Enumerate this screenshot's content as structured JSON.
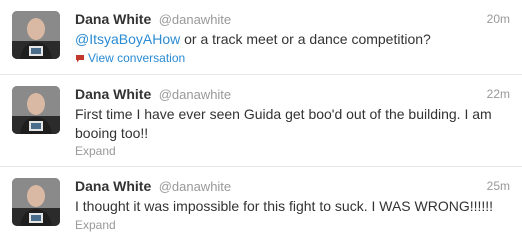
{
  "tweets": [
    {
      "name": "Dana White",
      "handle": "@danawhite",
      "time": "20m",
      "mention": "@ItsyaBoyAHow",
      "text": " or a track meet or a dance competition?",
      "action": "View conversation",
      "action_icon": "speech-bubble-icon"
    },
    {
      "name": "Dana White",
      "handle": "@danawhite",
      "time": "22m",
      "text": "First time I have ever seen Guida get boo'd out of the building. I am booing too!!",
      "action": "Expand"
    },
    {
      "name": "Dana White",
      "handle": "@danawhite",
      "time": "25m",
      "text": "I thought it was impossible for this fight to suck. I WAS WRONG!!!!!!",
      "action": "Expand"
    }
  ],
  "colors": {
    "link": "#2a8bd3",
    "muted": "#999999",
    "text": "#333333",
    "divider": "#e8e8e8"
  }
}
